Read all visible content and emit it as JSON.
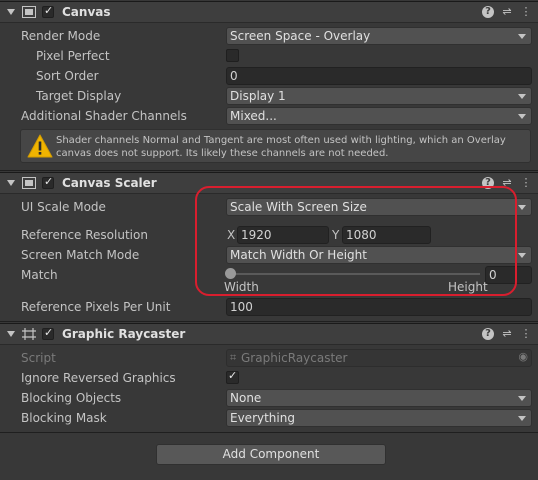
{
  "canvas": {
    "title": "Canvas",
    "enabled_check": "✓",
    "render_mode": {
      "label": "Render Mode",
      "value": "Screen Space - Overlay"
    },
    "pixel_perfect": {
      "label": "Pixel Perfect"
    },
    "sort_order": {
      "label": "Sort Order",
      "value": "0"
    },
    "target_display": {
      "label": "Target Display",
      "value": "Display 1"
    },
    "shader_channels": {
      "label": "Additional Shader Channels",
      "value": "Mixed..."
    },
    "warning": "Shader channels Normal and Tangent are most often used with lighting, which an Overlay canvas does not support. Its likely these channels are not needed."
  },
  "canvas_scaler": {
    "title": "Canvas Scaler",
    "enabled_check": "✓",
    "ui_scale_mode": {
      "label": "UI Scale Mode",
      "value": "Scale With Screen Size"
    },
    "reference_resolution": {
      "label": "Reference Resolution",
      "x_label": "X",
      "x": "1920",
      "y_label": "Y",
      "y": "1080"
    },
    "screen_match_mode": {
      "label": "Screen Match Mode",
      "value": "Match Width Or Height"
    },
    "match": {
      "label": "Match",
      "value": "0",
      "min_label": "Width",
      "max_label": "Height",
      "fraction": 0
    },
    "ref_pixels_per_unit": {
      "label": "Reference Pixels Per Unit",
      "value": "100"
    }
  },
  "graphic_raycaster": {
    "title": "Graphic Raycaster",
    "enabled_check": "✓",
    "script": {
      "label": "Script",
      "value": "GraphicRaycaster"
    },
    "ignore_reversed": {
      "label": "Ignore Reversed Graphics",
      "check": "✓"
    },
    "blocking_objects": {
      "label": "Blocking Objects",
      "value": "None"
    },
    "blocking_mask": {
      "label": "Blocking Mask",
      "value": "Everything"
    }
  },
  "add_component": "Add Component",
  "header_icons": [
    "help-icon",
    "preset-icon",
    "more-icon"
  ],
  "colors": {
    "highlight": "#d91e2e",
    "warning": "#f0b400"
  }
}
